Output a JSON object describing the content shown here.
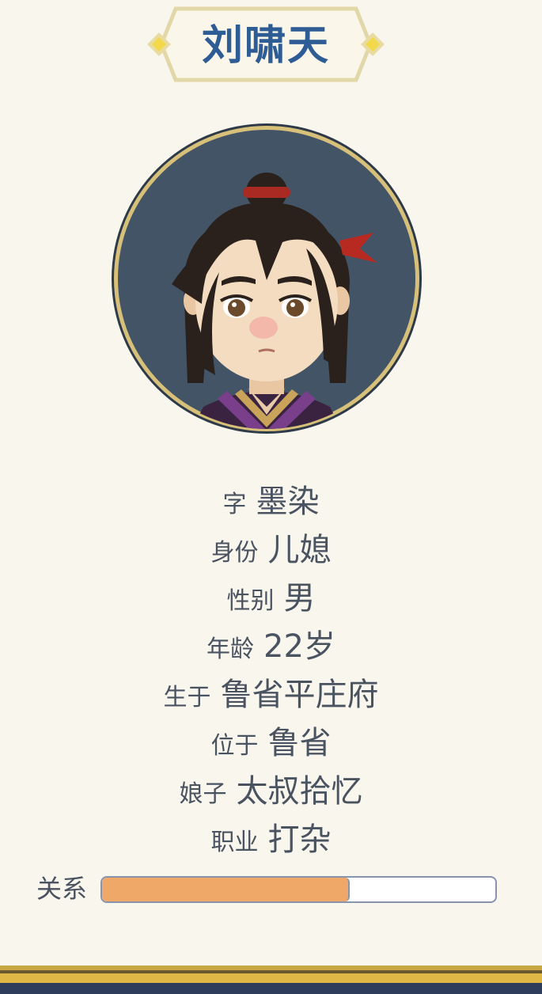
{
  "character": {
    "name": "刘啸天"
  },
  "details": [
    {
      "label": "字",
      "value": "墨染"
    },
    {
      "label": "身份",
      "value": "儿媳"
    },
    {
      "label": "性别",
      "value": "男"
    },
    {
      "label": "年龄",
      "value": "22岁"
    },
    {
      "label": "生于",
      "value": "鲁省平庄府"
    },
    {
      "label": "位于",
      "value": "鲁省"
    },
    {
      "label": "娘子",
      "value": "太叔拾忆"
    },
    {
      "label": "职业",
      "value": "打杂"
    }
  ],
  "relation": {
    "label": "关系",
    "fraction": 0.63
  },
  "colors": {
    "name": "#2e5c94",
    "text": "#4a5360",
    "relation_fill": "#f0a868",
    "background": "#f9f6ee"
  },
  "icons": {
    "portrait": "character-portrait",
    "banner_ornament": "diamond-ornament-icon"
  }
}
